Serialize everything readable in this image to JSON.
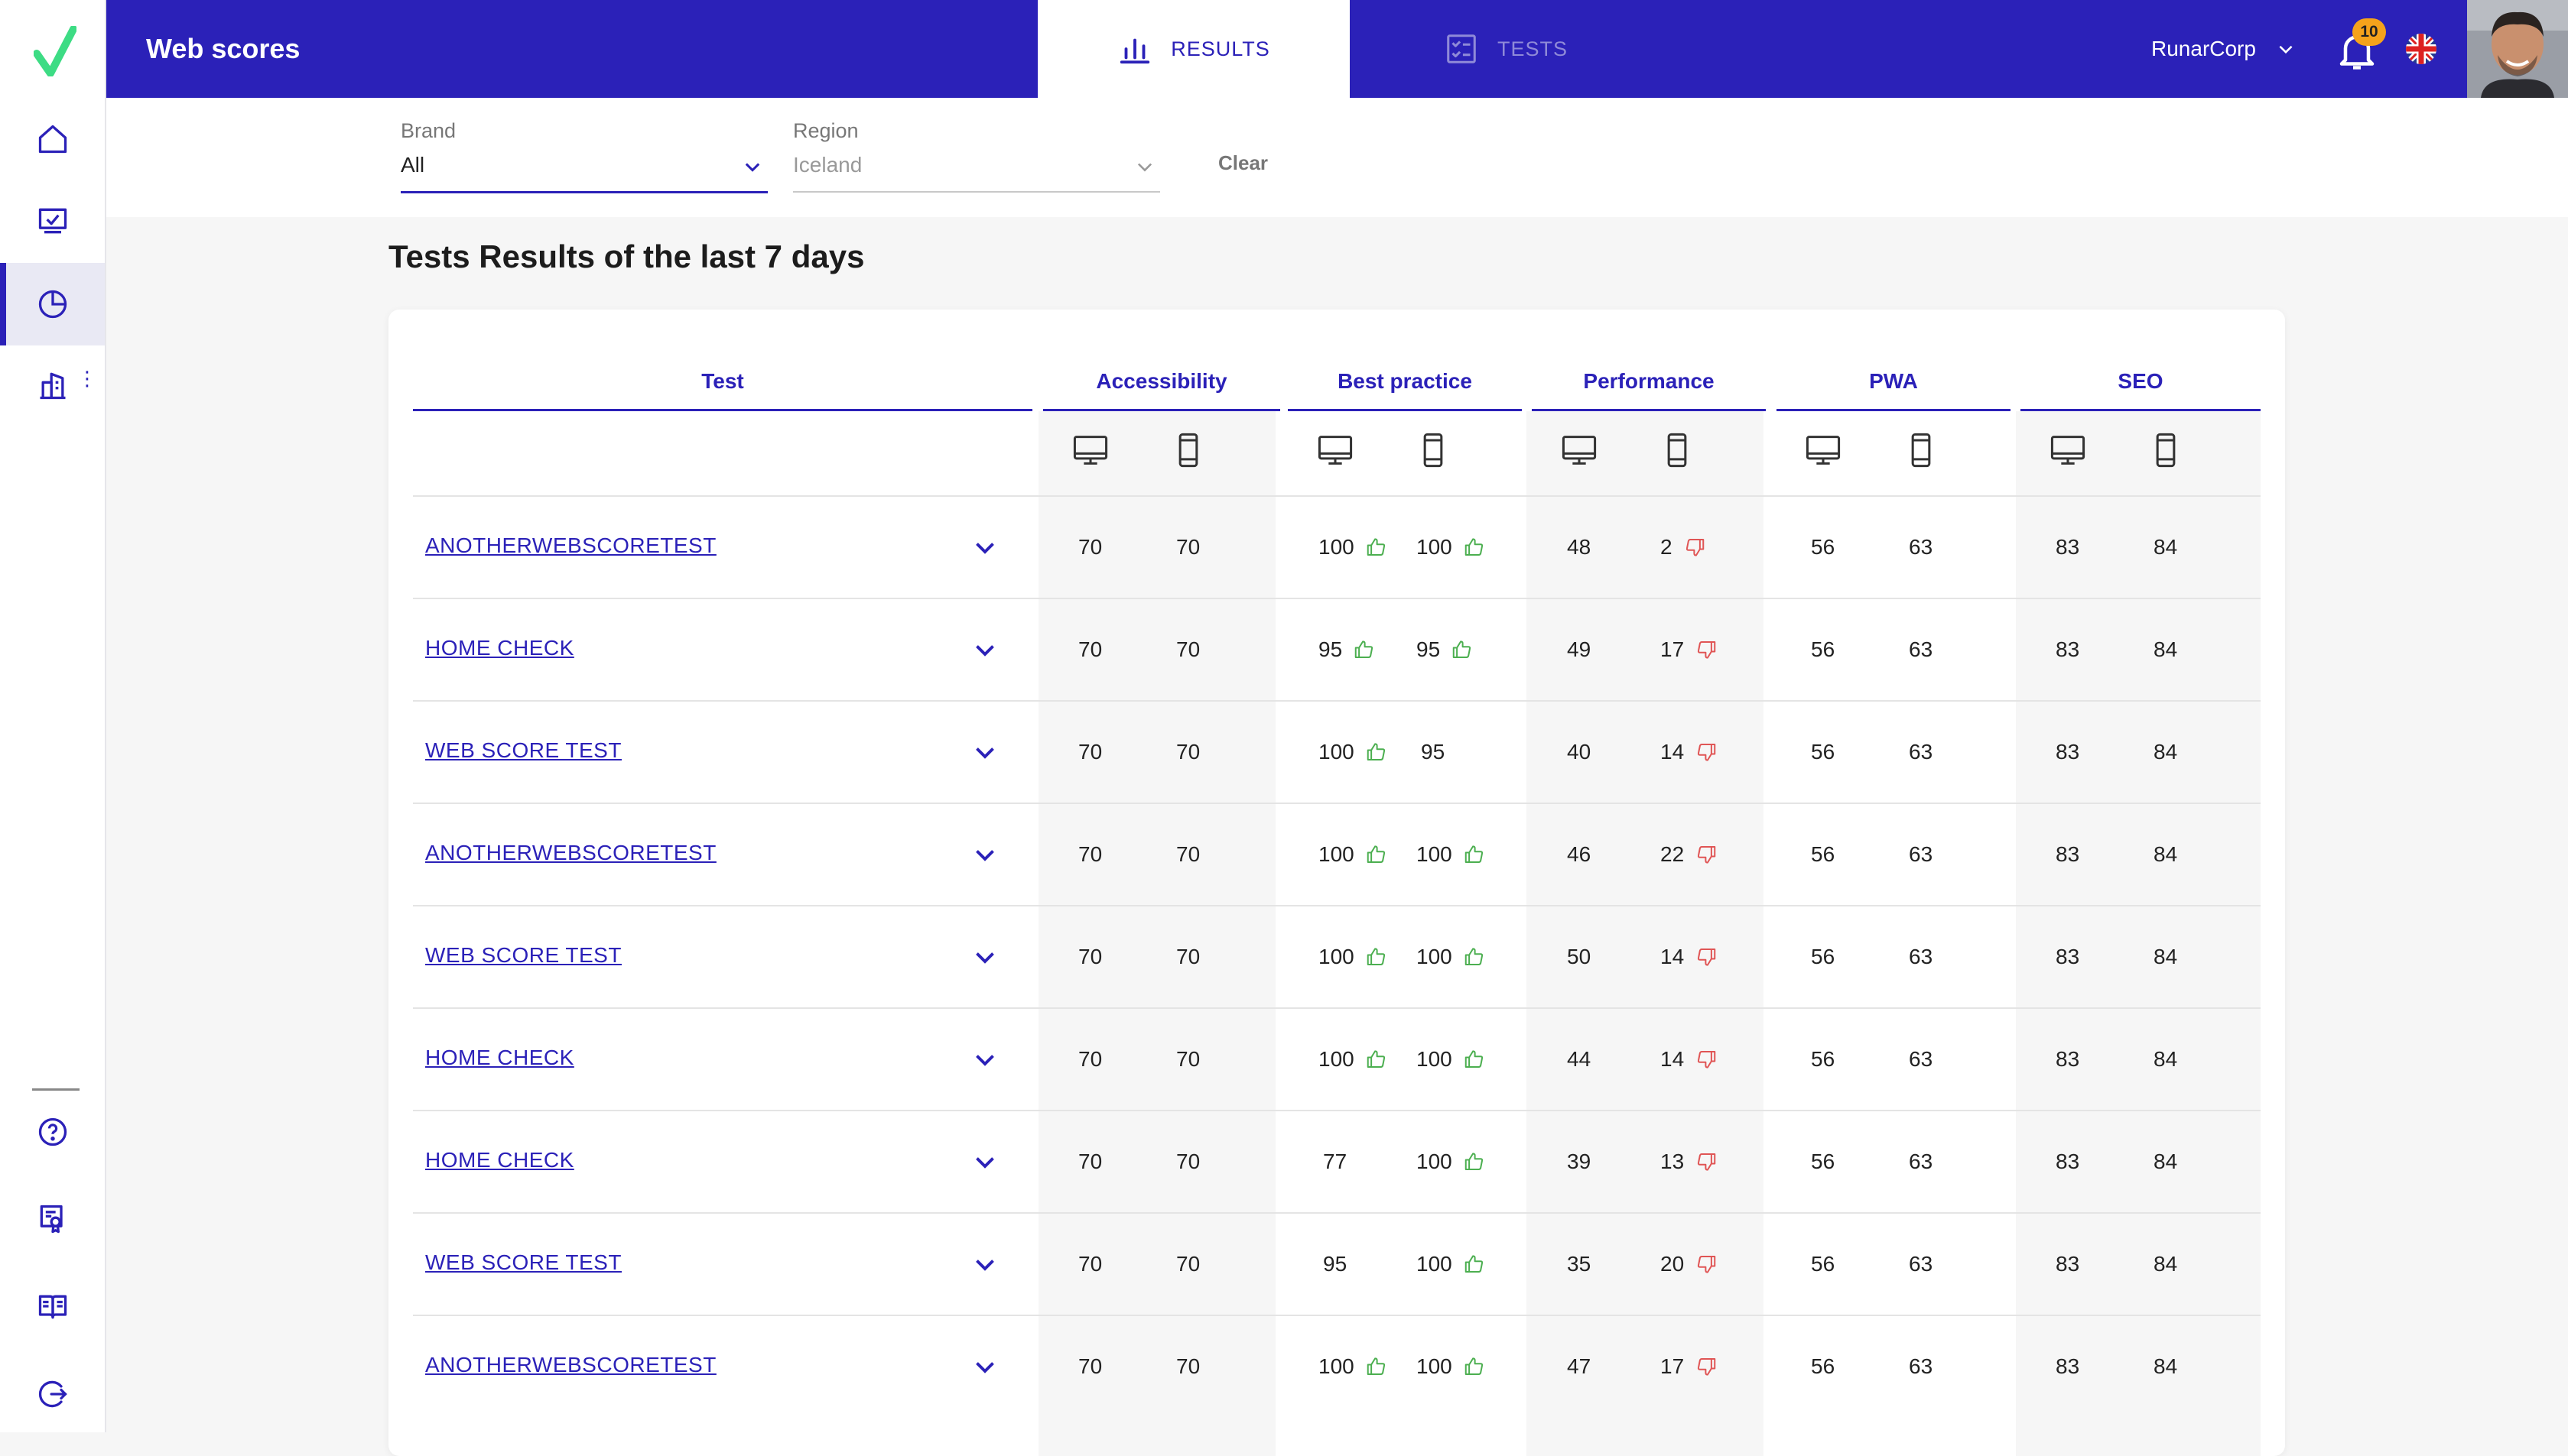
{
  "app": {
    "title": "Web scores"
  },
  "tabs": [
    {
      "label": "RESULTS",
      "active": true
    },
    {
      "label": "TESTS",
      "active": false
    }
  ],
  "user": {
    "org": "RunarCorp",
    "notifications": "10",
    "language_flag": "uk-flag"
  },
  "sidebar": {
    "items": [
      {
        "icon": "home-icon"
      },
      {
        "icon": "monitor-check-icon"
      },
      {
        "icon": "pie-chart-icon",
        "active": true
      },
      {
        "icon": "building-icon"
      }
    ],
    "bottom": [
      {
        "icon": "help-icon"
      },
      {
        "icon": "certificate-icon"
      },
      {
        "icon": "book-icon"
      },
      {
        "icon": "logout-icon"
      }
    ]
  },
  "filters": {
    "brand": {
      "label": "Brand",
      "value": "All"
    },
    "region": {
      "label": "Region",
      "value": "Iceland"
    },
    "clear_label": "Clear"
  },
  "page_title": "Tests Results of the last 7 days",
  "table": {
    "test_header": "Test",
    "groups": [
      "Accessibility",
      "Best practice",
      "Performance",
      "PWA",
      "SEO"
    ],
    "rows": [
      {
        "name": "ANOTHERWEBSCORETEST",
        "acc": [
          "70",
          "70"
        ],
        "bp": [
          [
            "100",
            "up"
          ],
          [
            "100",
            "up"
          ]
        ],
        "perf": [
          [
            "48",
            ""
          ],
          [
            "2",
            "down"
          ]
        ],
        "pwa": [
          "56",
          "63"
        ],
        "seo": [
          "83",
          "84"
        ]
      },
      {
        "name": "HOME CHECK",
        "acc": [
          "70",
          "70"
        ],
        "bp": [
          [
            "95",
            "up"
          ],
          [
            "95",
            "up"
          ]
        ],
        "perf": [
          [
            "49",
            ""
          ],
          [
            "17",
            "down"
          ]
        ],
        "pwa": [
          "56",
          "63"
        ],
        "seo": [
          "83",
          "84"
        ]
      },
      {
        "name": "WEB SCORE TEST",
        "acc": [
          "70",
          "70"
        ],
        "bp": [
          [
            "100",
            "up"
          ],
          [
            "95",
            ""
          ]
        ],
        "perf": [
          [
            "40",
            ""
          ],
          [
            "14",
            "down"
          ]
        ],
        "pwa": [
          "56",
          "63"
        ],
        "seo": [
          "83",
          "84"
        ]
      },
      {
        "name": "ANOTHERWEBSCORETEST",
        "acc": [
          "70",
          "70"
        ],
        "bp": [
          [
            "100",
            "up"
          ],
          [
            "100",
            "up"
          ]
        ],
        "perf": [
          [
            "46",
            ""
          ],
          [
            "22",
            "down"
          ]
        ],
        "pwa": [
          "56",
          "63"
        ],
        "seo": [
          "83",
          "84"
        ]
      },
      {
        "name": "WEB SCORE TEST",
        "acc": [
          "70",
          "70"
        ],
        "bp": [
          [
            "100",
            "up"
          ],
          [
            "100",
            "up"
          ]
        ],
        "perf": [
          [
            "50",
            ""
          ],
          [
            "14",
            "down"
          ]
        ],
        "pwa": [
          "56",
          "63"
        ],
        "seo": [
          "83",
          "84"
        ]
      },
      {
        "name": "HOME CHECK",
        "acc": [
          "70",
          "70"
        ],
        "bp": [
          [
            "100",
            "up"
          ],
          [
            "100",
            "up"
          ]
        ],
        "perf": [
          [
            "44",
            ""
          ],
          [
            "14",
            "down"
          ]
        ],
        "pwa": [
          "56",
          "63"
        ],
        "seo": [
          "83",
          "84"
        ]
      },
      {
        "name": "HOME CHECK",
        "acc": [
          "70",
          "70"
        ],
        "bp": [
          [
            "77",
            ""
          ],
          [
            "100",
            "up"
          ]
        ],
        "perf": [
          [
            "39",
            ""
          ],
          [
            "13",
            "down"
          ]
        ],
        "pwa": [
          "56",
          "63"
        ],
        "seo": [
          "83",
          "84"
        ]
      },
      {
        "name": "WEB SCORE TEST",
        "acc": [
          "70",
          "70"
        ],
        "bp": [
          [
            "95",
            ""
          ],
          [
            "100",
            "up"
          ]
        ],
        "perf": [
          [
            "35",
            ""
          ],
          [
            "20",
            "down"
          ]
        ],
        "pwa": [
          "56",
          "63"
        ],
        "seo": [
          "83",
          "84"
        ]
      },
      {
        "name": "ANOTHERWEBSCORETEST",
        "acc": [
          "70",
          "70"
        ],
        "bp": [
          [
            "100",
            "up"
          ],
          [
            "100",
            "up"
          ]
        ],
        "perf": [
          [
            "47",
            ""
          ],
          [
            "17",
            "down"
          ]
        ],
        "pwa": [
          "56",
          "63"
        ],
        "seo": [
          "83",
          "84"
        ]
      }
    ]
  },
  "colors": {
    "primary": "#2b21b8",
    "thumb_up": "#4caf50",
    "thumb_down": "#e05555",
    "accent_logo": "#3ddc84"
  }
}
